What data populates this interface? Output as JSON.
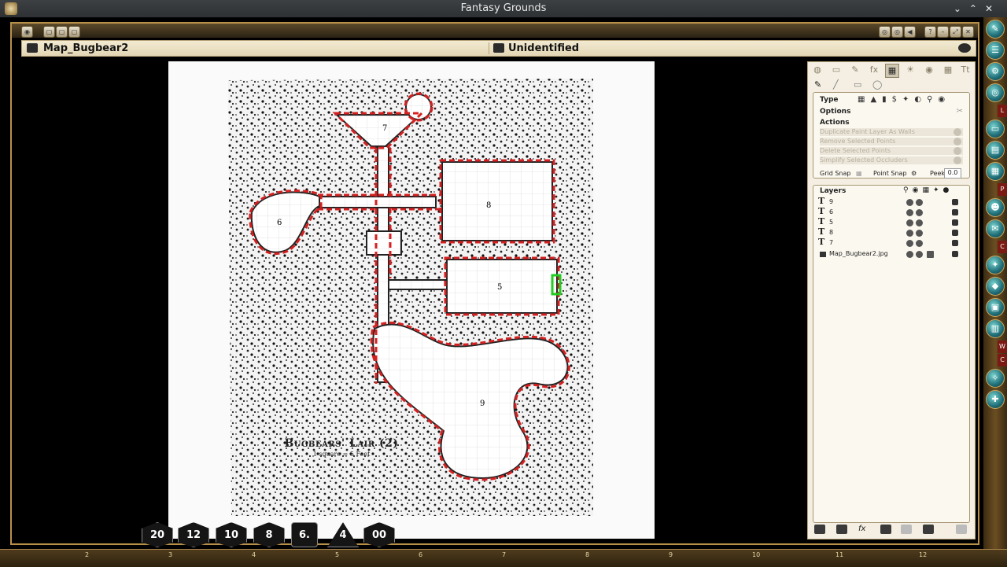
{
  "window": {
    "title": "Fantasy Grounds"
  },
  "map_window": {
    "name": "Map_Bugbear2",
    "status": "Unidentified"
  },
  "map": {
    "caption_title": "Bugbears' Lair (2)",
    "caption_scale": "1 square = 5 Feet",
    "room_labels": [
      "7",
      "8",
      "6",
      "5",
      "9"
    ]
  },
  "panel": {
    "type_label": "Type",
    "options_label": "Options",
    "actions_label": "Actions",
    "actions": [
      "Duplicate Paint Layer As Walls",
      "Remove Selected Points",
      "Delete Selected Points",
      "Simplify Selected Occluders"
    ],
    "grid_snap_label": "Grid Snap",
    "point_snap_label": "Point Snap",
    "peek_label": "Peek",
    "peek_value": "0.0",
    "layers_label": "Layers",
    "layers": [
      {
        "kind": "T",
        "name": "9"
      },
      {
        "kind": "T",
        "name": "6"
      },
      {
        "kind": "T",
        "name": "5"
      },
      {
        "kind": "T",
        "name": "8"
      },
      {
        "kind": "T",
        "name": "7"
      },
      {
        "kind": "image",
        "name": "Map_Bugbear2.jpg"
      }
    ]
  },
  "dice": [
    "20",
    "12",
    "10",
    "8",
    "6.",
    "4",
    "00"
  ],
  "ruler_numbers": [
    "2",
    "3",
    "4",
    "5",
    "6",
    "7",
    "8",
    "9",
    "10",
    "11",
    "12"
  ],
  "side_tabs": [
    "L",
    "P",
    "C",
    "W",
    "C"
  ],
  "colors": {
    "occluder": "#d42020",
    "frame": "#b9904a",
    "panel_bg": "#f4efe2"
  }
}
